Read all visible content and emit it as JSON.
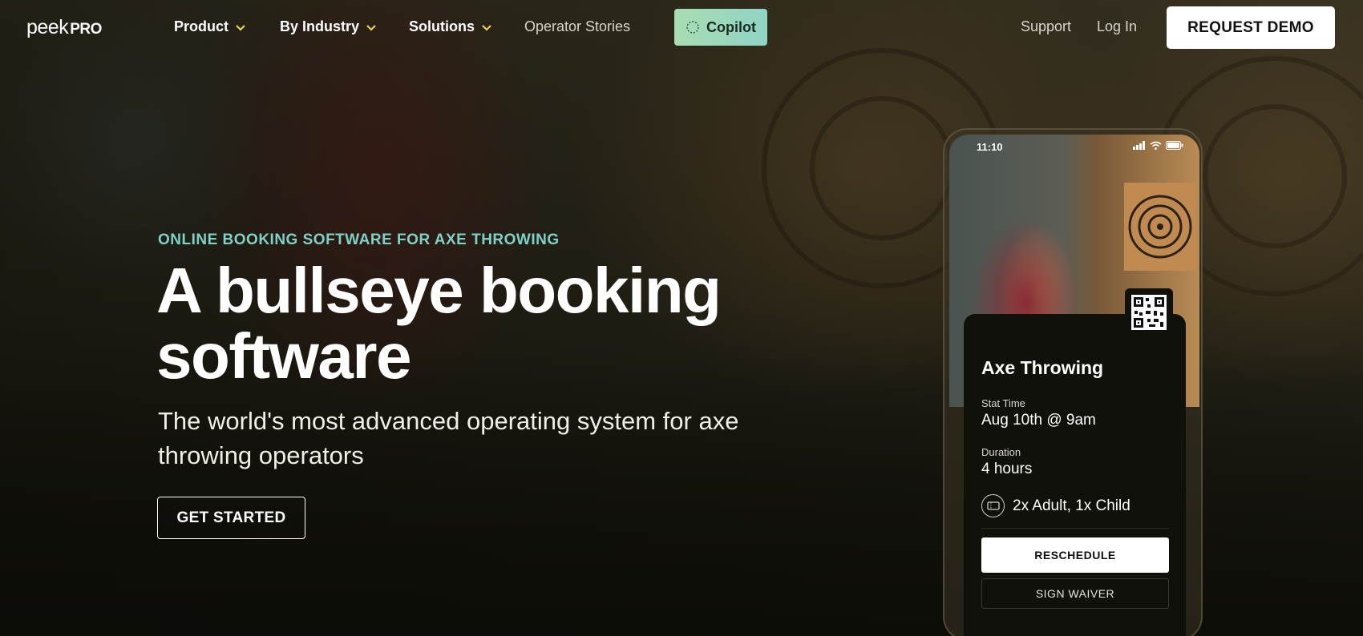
{
  "nav": {
    "logo_peek": "peek",
    "logo_pro": "PRO",
    "items": [
      {
        "label": "Product"
      },
      {
        "label": "By Industry"
      },
      {
        "label": "Solutions"
      },
      {
        "label": "Operator Stories"
      }
    ],
    "copilot_label": "Copilot",
    "support_label": "Support",
    "login_label": "Log In",
    "demo_label": "REQUEST DEMO",
    "chevron_color": "#e8d34a"
  },
  "hero": {
    "eyebrow": "ONLINE BOOKING SOFTWARE FOR AXE THROWING",
    "headline": "A bullseye booking software",
    "subhead": "The world's most advanced operating system for axe throwing operators",
    "cta_label": "GET STARTED"
  },
  "phone": {
    "status_time": "11:10",
    "card": {
      "title": "Axe Throwing",
      "start_label": "Stat Time",
      "start_value": "Aug 10th @ 9am",
      "duration_label": "Duration",
      "duration_value": "4 hours",
      "tickets": "2x Adult, 1x Child",
      "reschedule_label": "RESCHEDULE",
      "waiver_label": "SIGN WAIVER"
    }
  },
  "colors": {
    "accent_teal": "#7fd1c6",
    "copilot_green": "#a9ddb3"
  }
}
